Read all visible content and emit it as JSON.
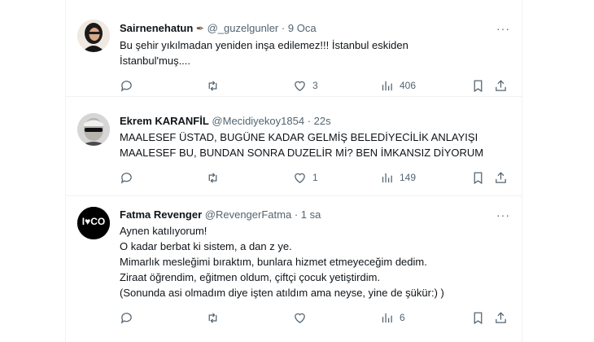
{
  "tweets": [
    {
      "name": "Sairnenehatun",
      "handle": "@_guzelgunler",
      "dot": "·",
      "time": "9 Oca",
      "lines": [
        "Bu şehir yıkılmadan yeniden inşa edilemez!!!  İstanbul eskiden",
        "İstanbul'muş...."
      ],
      "replies": "",
      "retweets": "",
      "likes": "3",
      "views": "406"
    },
    {
      "name": "Ekrem KARANFİL",
      "handle": "@Mecidiyekoy1854",
      "dot": "·",
      "time": "22s",
      "lines": [
        "MAALESEF ÜSTAD, BUGÜNE KADAR GELMİŞ BELEDİYECİLİK ANLAYIŞI",
        "MAALESEF BU, BUNDAN SONRA DUZELİR Mİ? BEN İMKANSIZ DİYORUM"
      ],
      "replies": "",
      "retweets": "",
      "likes": "1",
      "views": "149"
    },
    {
      "name": "Fatma Revenger",
      "handle": "@RevengerFatma",
      "dot": "·",
      "time": "1 sa",
      "lines": [
        "Aynen katılıyorum!",
        "O kadar berbat ki sistem, a dan z ye.",
        "Mimarlık mesleğimi bıraktım, bunlara hizmet etmeyeceğim dedim.",
        "Ziraat öğrendim, eğitmen oldum, çiftçi çocuk yetiştirdim.",
        "(Sonunda asi olmadım diye işten atıldım ama neyse, yine de şükür:) )"
      ],
      "replies": "",
      "retweets": "",
      "likes": "",
      "views": "6"
    }
  ],
  "avatar3_text": "I♥CO",
  "colors": {
    "text": "#0f1419",
    "muted": "#536471",
    "border": "#eff3f4",
    "heart": "#2ecc40"
  }
}
